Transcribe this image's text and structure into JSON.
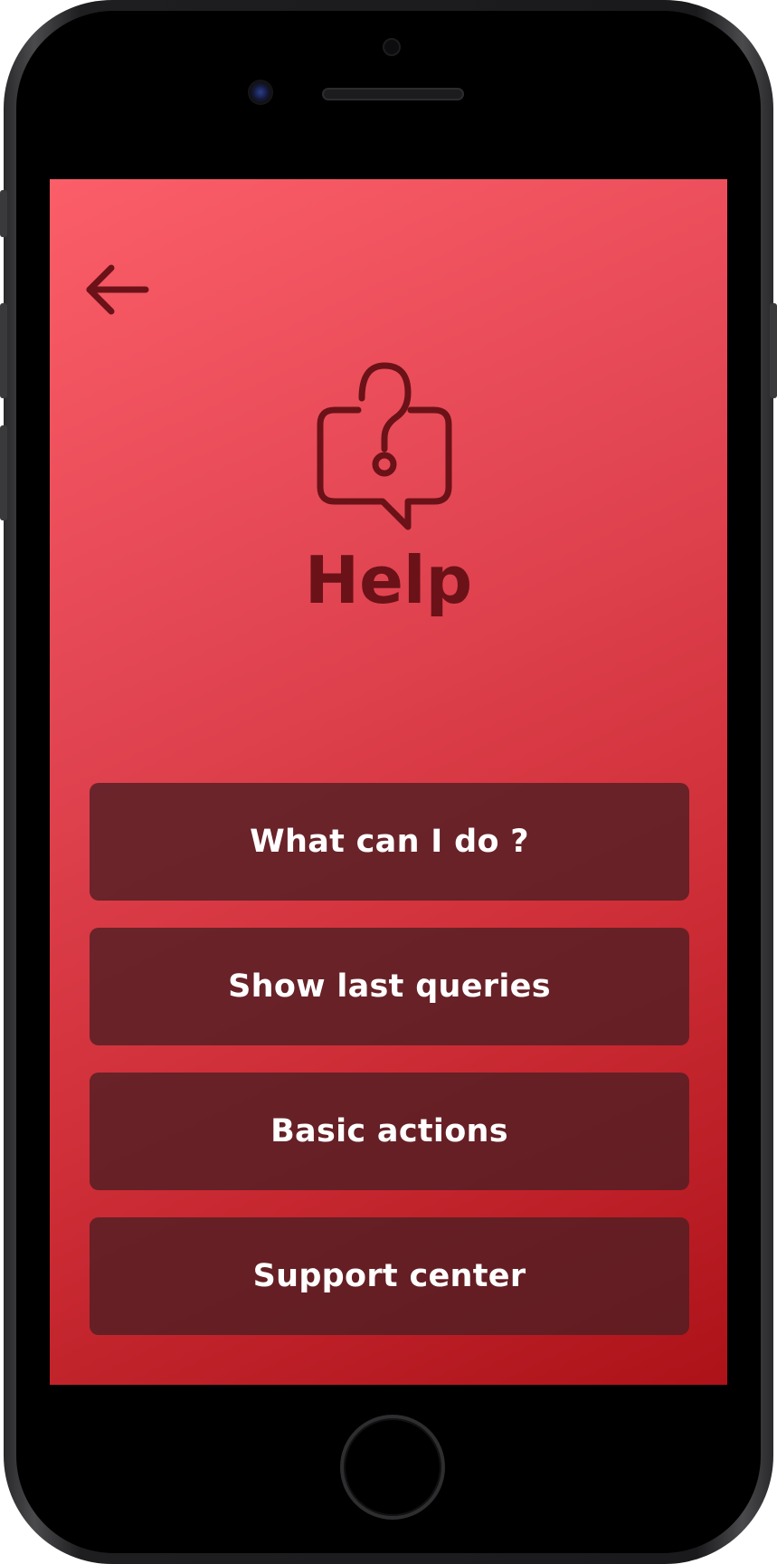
{
  "screen": {
    "title": "Help",
    "back_icon": "arrow-left-icon",
    "hero_icon": "question-bubble-icon"
  },
  "menu": {
    "items": [
      {
        "label": "What can I do ?"
      },
      {
        "label": "Show last queries"
      },
      {
        "label": "Basic actions"
      },
      {
        "label": "Support center"
      }
    ]
  },
  "colors": {
    "gradient_start": "#fb5e68",
    "gradient_end": "#ad1219",
    "icon_and_title": "#6a1218",
    "button_bg": "#5a1f25",
    "button_text": "#ffffff"
  }
}
